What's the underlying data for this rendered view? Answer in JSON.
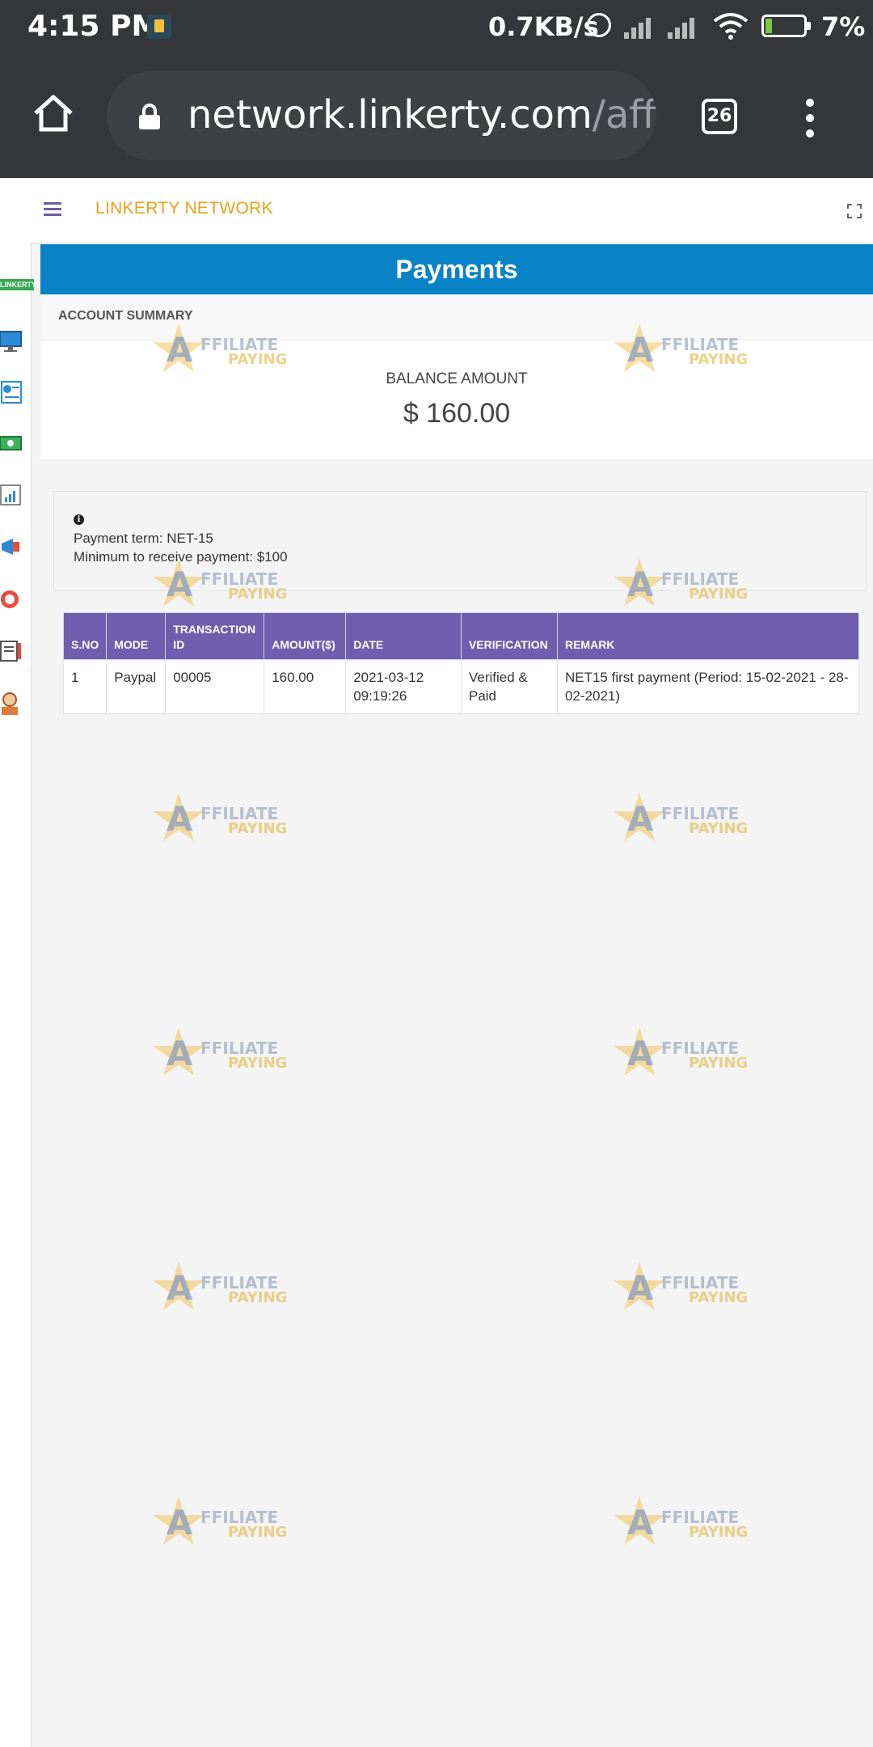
{
  "status_bar": {
    "time": "4:15 PM",
    "net_speed": "0.7KB/s",
    "battery": "7%"
  },
  "browser": {
    "url_main": "network.linkerty.com",
    "url_rest": "/affi",
    "tab_count": "26"
  },
  "app": {
    "brand": "LINKERTY NETWORK",
    "sidebar_logo": "LINKERTY"
  },
  "payments": {
    "title": "Payments",
    "summary_heading": "ACCOUNT SUMMARY",
    "balance_label": "BALANCE AMOUNT",
    "balance_amount": "$ 160.00",
    "info": {
      "payment_term": "Payment term: NET-15",
      "minimum": "Minimum to receive payment: $100"
    },
    "table": {
      "headers": [
        "S.NO",
        "MODE",
        "TRANSACTION ID",
        "AMOUNT($)",
        "DATE",
        "VERIFICATION",
        "REMARK"
      ],
      "rows": [
        [
          "1",
          "Paypal",
          "00005",
          "160.00",
          "2021-03-12 09:19:26",
          "Verified & Paid",
          "NET15 first payment (Period: 15-02-2021 - 28-02-2021)"
        ]
      ]
    }
  },
  "watermark": {
    "letter": "A",
    "word1": "FFILIATE",
    "word2": "PAYING"
  },
  "colors": {
    "panel_blue": "#0a82c6",
    "table_header_purple": "#6f5fae",
    "brand_orange": "#e8a11a",
    "verified_teal": "#1fa9a0"
  }
}
